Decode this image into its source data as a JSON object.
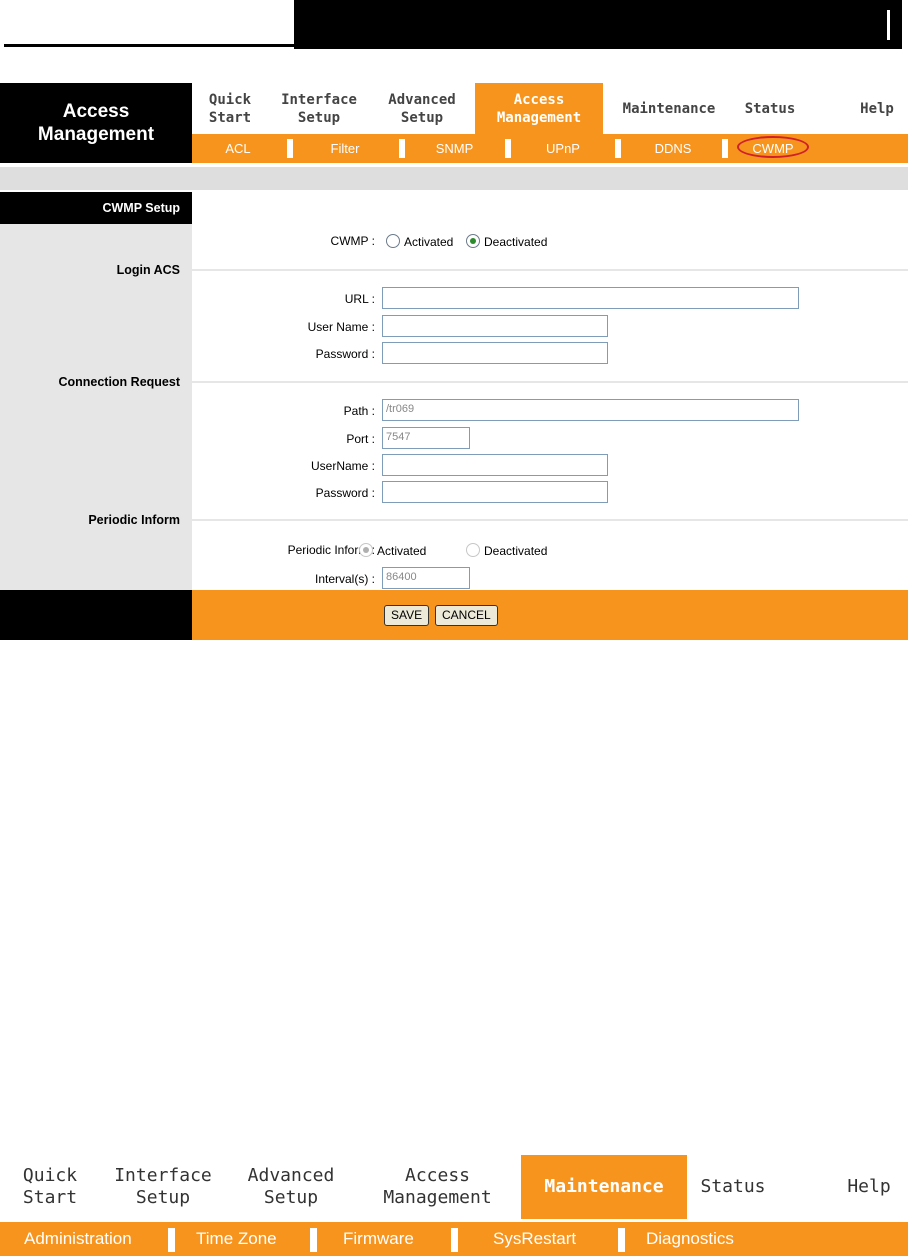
{
  "page": {
    "label_line1": "Access",
    "label_line2": "Management"
  },
  "nav": [
    {
      "label": "Quick\nStart"
    },
    {
      "label": "Interface\nSetup"
    },
    {
      "label": "Advanced\nSetup"
    },
    {
      "label": "Access\nManagement",
      "active": true
    },
    {
      "label": "Maintenance"
    },
    {
      "label": "Status"
    },
    {
      "label": "Help"
    }
  ],
  "subnav": [
    {
      "label": "ACL"
    },
    {
      "label": "Filter"
    },
    {
      "label": "SNMP"
    },
    {
      "label": "UPnP"
    },
    {
      "label": "DDNS"
    },
    {
      "label": "CWMP",
      "active": true
    }
  ],
  "sections": {
    "cwmp_setup": "CWMP Setup",
    "login_acs": "Login ACS",
    "connection_request": "Connection Request",
    "periodic_inform": "Periodic Inform"
  },
  "cwmp": {
    "label": "CWMP :",
    "options": [
      {
        "label": "Activated",
        "checked": false
      },
      {
        "label": "Deactivated",
        "checked": true
      }
    ]
  },
  "login_acs": {
    "url_label": "URL :",
    "url_value": "",
    "username_label": "User Name :",
    "username_value": "",
    "password_label": "Password :",
    "password_value": ""
  },
  "connection_request": {
    "path_label": "Path :",
    "path_value": "/tr069",
    "port_label": "Port :",
    "port_value": "7547",
    "username_label": "UserName :",
    "username_value": "",
    "password_label": "Password :",
    "password_value": ""
  },
  "periodic_inform": {
    "label": "Periodic Inform :",
    "options": [
      {
        "label": "Activated",
        "checked": true
      },
      {
        "label": "Deactivated",
        "checked": false
      }
    ],
    "interval_label": "Interval(s) :",
    "interval_value": "86400"
  },
  "buttons": {
    "save": "SAVE",
    "cancel": "CANCEL"
  },
  "bottom_nav": [
    {
      "label": "Quick\nStart"
    },
    {
      "label": "Interface\nSetup"
    },
    {
      "label": "Advanced\nSetup"
    },
    {
      "label": "Access\nManagement"
    },
    {
      "label": "Maintenance",
      "active": true
    },
    {
      "label": "Status"
    },
    {
      "label": "Help"
    }
  ],
  "bottom_subnav": [
    {
      "label": "Administration"
    },
    {
      "label": "Time Zone"
    },
    {
      "label": "Firmware"
    },
    {
      "label": "SysRestart"
    },
    {
      "label": "Diagnostics"
    }
  ],
  "colors": {
    "accent": "#f7941d",
    "panel_grey": "#e6e6e6",
    "highlight_ring": "#d0202a"
  }
}
